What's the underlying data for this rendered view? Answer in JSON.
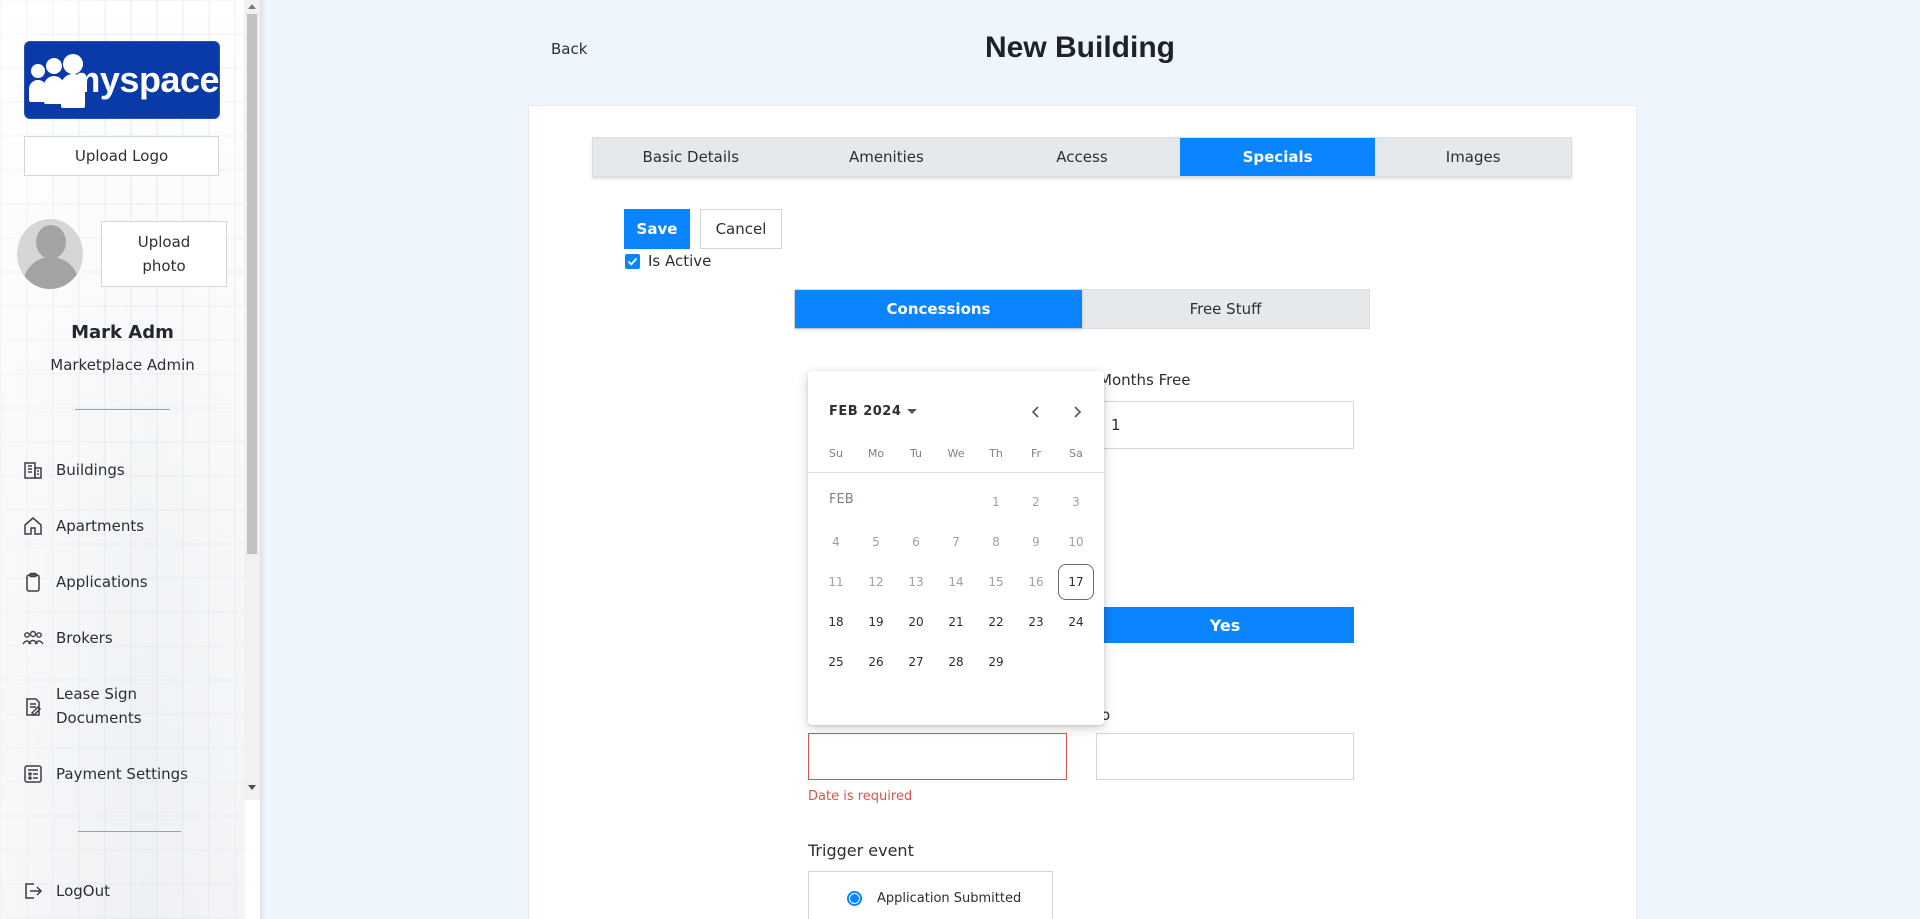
{
  "sidebar": {
    "logo_text": "myspace",
    "upload_logo": "Upload Logo",
    "upload_photo": "Upload photo",
    "user_name": "Mark Adm",
    "user_role": "Marketplace Admin",
    "items": [
      {
        "label": "Buildings",
        "icon": "buildings-icon"
      },
      {
        "label": "Apartments",
        "icon": "home-icon"
      },
      {
        "label": "Applications",
        "icon": "clipboard-icon"
      },
      {
        "label": "Brokers",
        "icon": "users-icon"
      },
      {
        "label": "Lease Sign Documents",
        "icon": "document-edit-icon"
      },
      {
        "label": "Payment Settings",
        "icon": "payment-settings-icon"
      }
    ],
    "logout": "LogOut"
  },
  "header": {
    "back": "Back",
    "title": "New Building"
  },
  "tabs": [
    {
      "label": "Basic Details",
      "active": false
    },
    {
      "label": "Amenities",
      "active": false
    },
    {
      "label": "Access",
      "active": false
    },
    {
      "label": "Specials",
      "active": true
    },
    {
      "label": "Images",
      "active": false
    }
  ],
  "actions": {
    "save": "Save",
    "cancel": "Cancel",
    "is_active_label": "Is Active",
    "is_active": true
  },
  "segments": [
    {
      "label": "Concessions",
      "active": true
    },
    {
      "label": "Free Stuff",
      "active": false
    }
  ],
  "form": {
    "months_free_label": "Months Free",
    "months_free_value": "1",
    "yes_label": "Yes",
    "to_label_fragment": "o",
    "date_error": "Date is required",
    "trigger_label": "Trigger event",
    "trigger_option": "Application Submitted"
  },
  "calendar": {
    "month_label": "FEB 2024",
    "weekdays": [
      "Su",
      "Mo",
      "Tu",
      "We",
      "Th",
      "Fr",
      "Sa"
    ],
    "row_label": "FEB",
    "weeks": [
      [
        "",
        "",
        "",
        "",
        "1",
        "2",
        "3"
      ],
      [
        "4",
        "5",
        "6",
        "7",
        "8",
        "9",
        "10"
      ],
      [
        "11",
        "12",
        "13",
        "14",
        "15",
        "16",
        "17"
      ],
      [
        "18",
        "19",
        "20",
        "21",
        "22",
        "23",
        "24"
      ],
      [
        "25",
        "26",
        "27",
        "28",
        "29",
        "",
        ""
      ]
    ],
    "today": "17",
    "disabled_before": 17
  },
  "colors": {
    "accent": "#0a84ff",
    "error": "#d9534f",
    "logo_bg": "#0a3aa8"
  }
}
